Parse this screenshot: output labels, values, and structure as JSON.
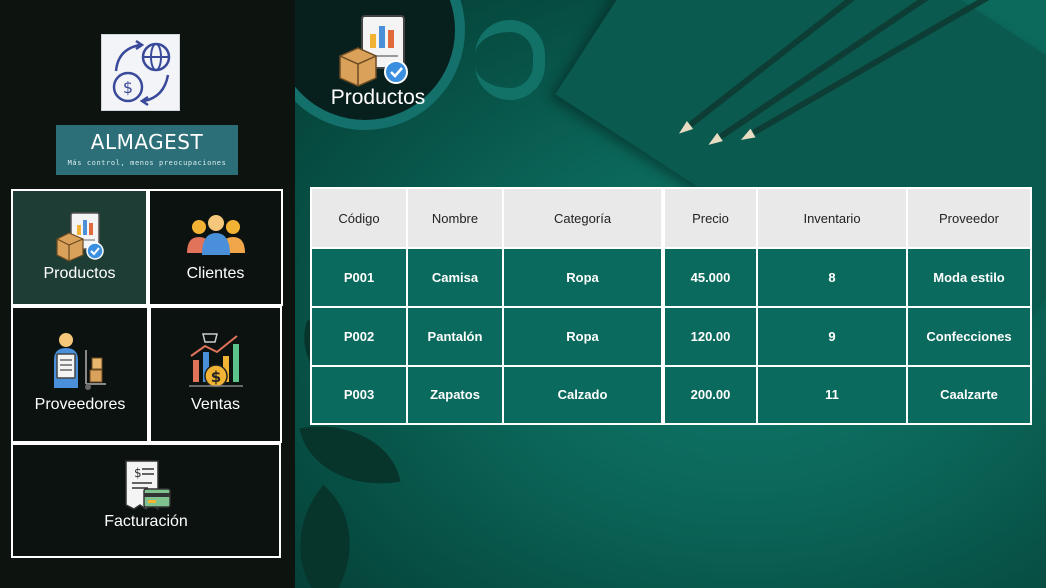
{
  "brand": {
    "name": "ALMAGEST",
    "tagline": "Más control, menos preocupaciones"
  },
  "nav": {
    "productos": "Productos",
    "clientes": "Clientes",
    "proveedores": "Proveedores",
    "ventas": "Ventas",
    "facturacion": "Facturación",
    "active": "productos"
  },
  "page": {
    "title": "Productos"
  },
  "table": {
    "headers": [
      "Código",
      "Nombre",
      "Categoría",
      "Precio",
      "Inventario",
      "Proveedor"
    ],
    "rows": [
      [
        "P001",
        "Camisa",
        "Ropa",
        "45.000",
        "8",
        "Moda estilo"
      ],
      [
        "P002",
        "Pantalón",
        "Ropa",
        "120.00",
        "9",
        "Confecciones"
      ],
      [
        "P003",
        "Zapatos",
        "Calzado",
        "200.00",
        "11",
        "Caalzarte"
      ]
    ]
  },
  "colors": {
    "sidebar": "#0d1410",
    "accent": "#0b6a5e",
    "header_cell": "#e9e9e9"
  }
}
